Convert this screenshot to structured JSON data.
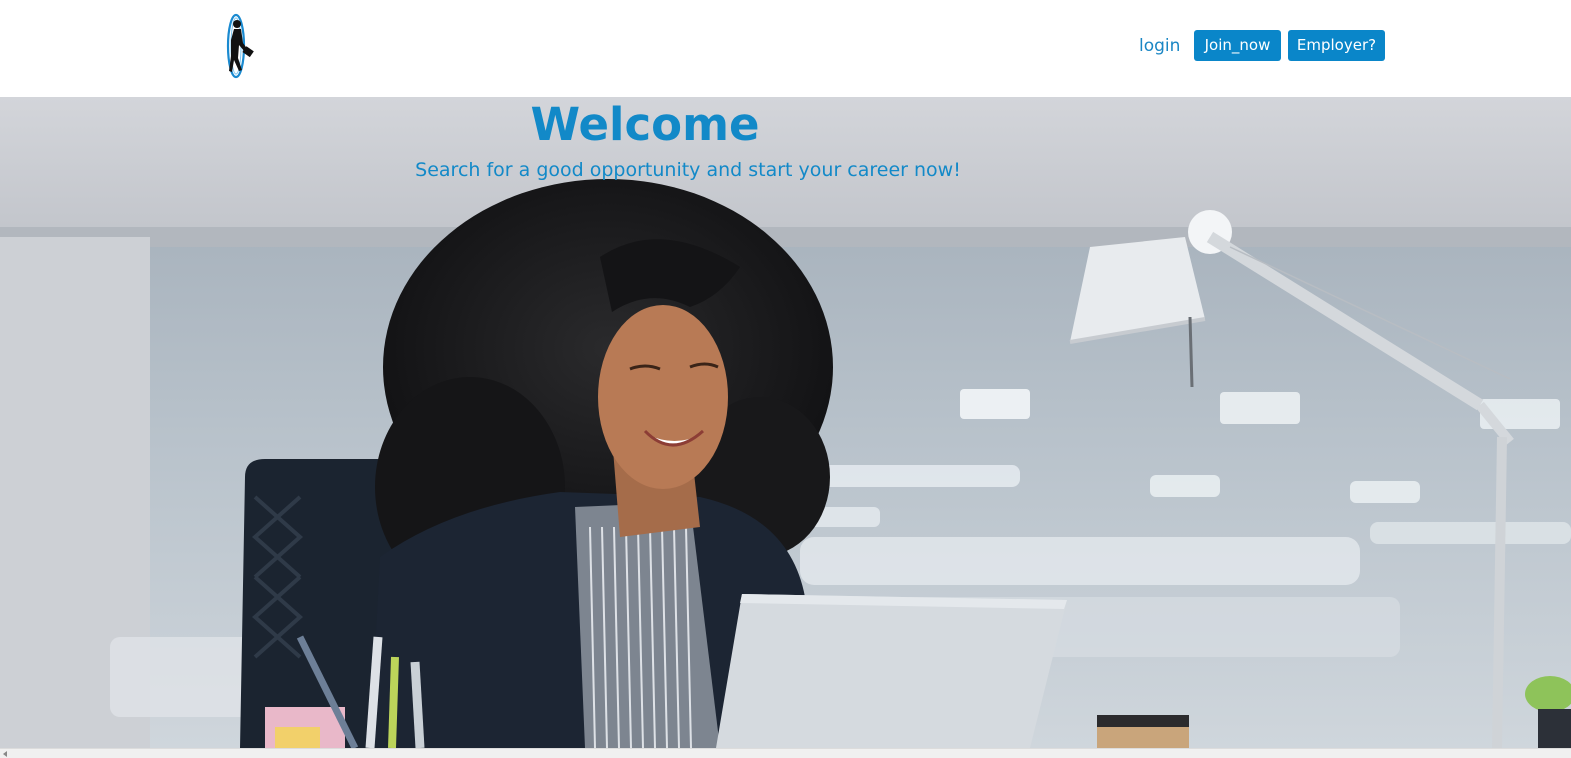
{
  "header": {
    "logo_icon": "job-seeker-logo-icon",
    "login_label": "login",
    "join_label": "Join_now",
    "employer_label": "Employer?"
  },
  "hero": {
    "title": "Welcome",
    "subtitle": "Search for a good opportunity and start your career now!",
    "image": "woman-at-laptop-office-photo"
  },
  "colors": {
    "accent": "#0a86c9",
    "title": "#1289c8"
  }
}
